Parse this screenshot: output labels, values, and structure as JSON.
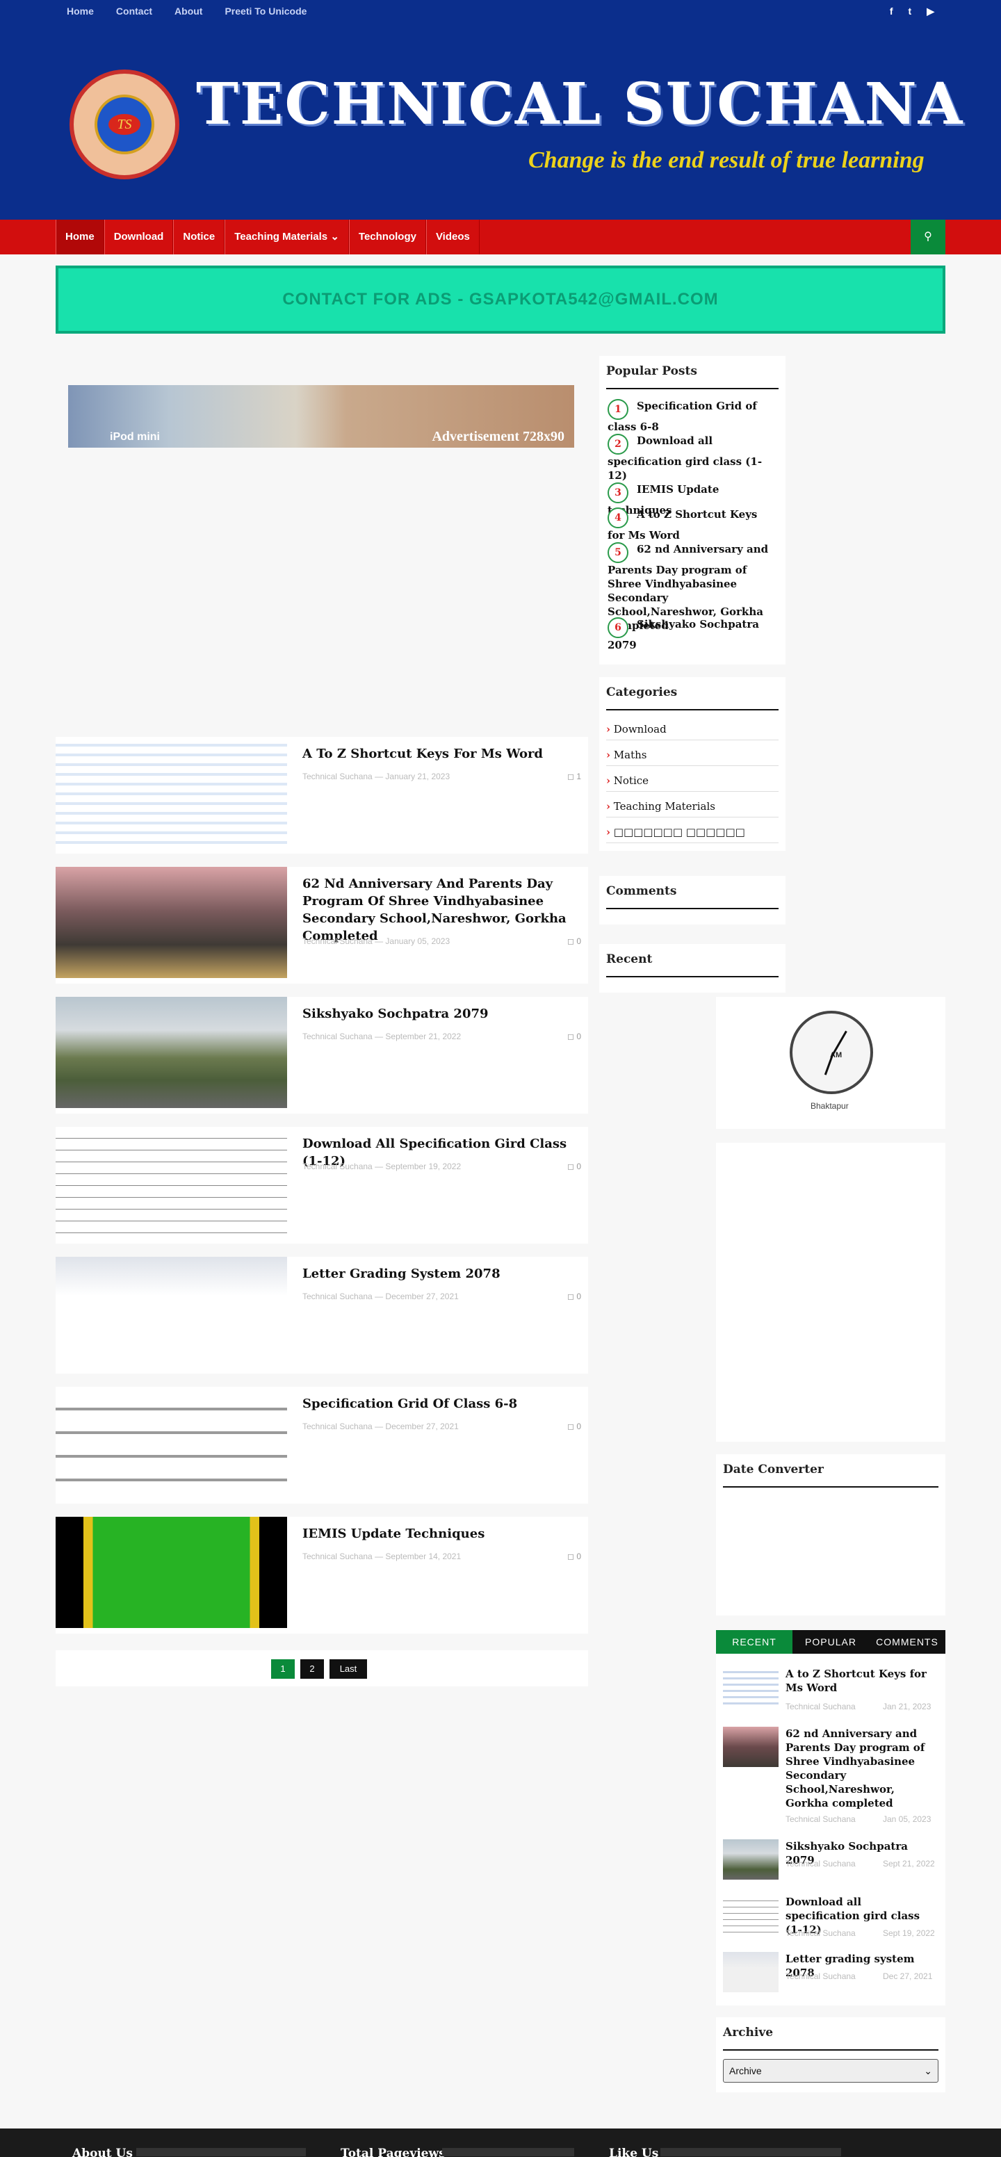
{
  "topnav": {
    "links": [
      "Home",
      "Contact",
      "About",
      "Preeti To Unicode"
    ]
  },
  "site": {
    "title": "TECHNICAL SUCHANA",
    "tagline": "Change is the end result of true learning",
    "logo_text": "TS"
  },
  "nav": {
    "items": [
      "Home",
      "Download",
      "Notice",
      "Teaching Materials",
      "Technology",
      "Videos"
    ]
  },
  "ads": {
    "text": "CONTACT FOR ADS - GSAPKOTA542@GMAIL.COM"
  },
  "adimage": {
    "text": "Advertisement 728x90",
    "ipod": "iPod mini"
  },
  "posts": [
    {
      "title": "A To Z Shortcut Keys For Ms Word",
      "author": "Technical Suchana",
      "date": "January 21, 2023",
      "comments": "1"
    },
    {
      "title": "62 Nd Anniversary And Parents Day Program Of Shree Vindhyabasinee Secondary School,Nareshwor, Gorkha Completed",
      "author": "Technical Suchana",
      "date": "January 05, 2023",
      "comments": "0"
    },
    {
      "title": "Sikshyako Sochpatra 2079",
      "author": "Technical Suchana",
      "date": "September 21, 2022",
      "comments": "0"
    },
    {
      "title": "Download All Specification Gird Class (1-12)",
      "author": "Technical Suchana",
      "date": "September 19, 2022",
      "comments": "0"
    },
    {
      "title": "Letter Grading System 2078",
      "author": "Technical Suchana",
      "date": "December 27, 2021",
      "comments": "0"
    },
    {
      "title": "Specification Grid Of Class 6-8",
      "author": "Technical Suchana",
      "date": "December 27, 2021",
      "comments": "0"
    },
    {
      "title": "IEMIS Update Techniques",
      "author": "Technical Suchana",
      "date": "September 14, 2021",
      "comments": "0"
    }
  ],
  "pager": {
    "p1": "1",
    "p2": "2",
    "last": "Last"
  },
  "popular": {
    "title": "Popular Posts",
    "items": [
      "Specification Grid of class 6-8",
      "Download all specification gird class (1-12)",
      "IEMIS Update techniques",
      "A to Z Shortcut Keys for Ms Word",
      "62 nd Anniversary and Parents Day program of Shree Vindhyabasinee Secondary School,Nareshwor, Gorkha completed",
      "Sikshyako Sochpatra 2079"
    ]
  },
  "categories": {
    "title": "Categories",
    "items": [
      "Download",
      "Maths",
      "Notice",
      "Teaching Materials",
      "□□□□□□□ □□□□□□"
    ]
  },
  "comments_widget": {
    "title": "Comments"
  },
  "recent_widget": {
    "title": "Recent"
  },
  "clock": {
    "label": "Bhaktapur",
    "am": "AM"
  },
  "date_converter": {
    "title": "Date Converter"
  },
  "tabs": [
    "RECENT",
    "POPULAR",
    "COMMENTS"
  ],
  "recent_posts": [
    {
      "title": "A to Z Shortcut Keys for Ms Word",
      "author": "Technical Suchana",
      "date": "Jan 21, 2023"
    },
    {
      "title": "62 nd Anniversary and Parents Day program of Shree Vindhyabasinee Secondary School,Nareshwor, Gorkha completed",
      "author": "Technical Suchana",
      "date": "Jan 05, 2023"
    },
    {
      "title": "Sikshyako Sochpatra 2079",
      "author": "Technical Suchana",
      "date": "Sept 21, 2022"
    },
    {
      "title": "Download all specification gird class (1-12)",
      "author": "Technical Suchana",
      "date": "Sept 19, 2022"
    },
    {
      "title": "Letter grading system 2078",
      "author": "Technical Suchana",
      "date": "Dec 27, 2021"
    }
  ],
  "archive": {
    "title": "Archive",
    "selected": "Archive"
  },
  "footer": {
    "about": "About Us",
    "pageviews": "Total Pageviews",
    "like": "Like Us"
  }
}
